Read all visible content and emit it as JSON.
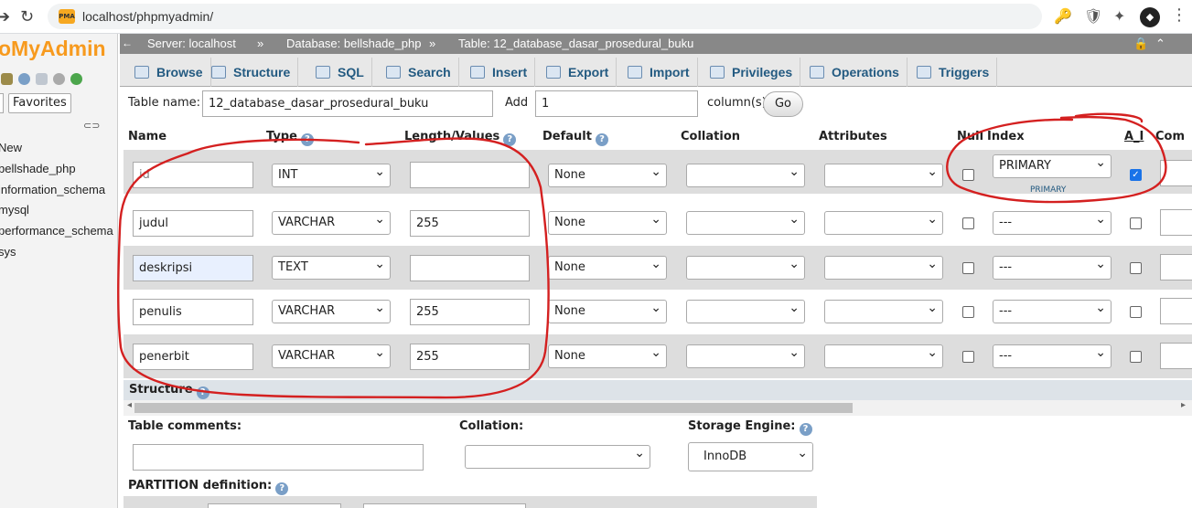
{
  "browser": {
    "url": "localhost/phpmyadmin/",
    "favicon_text": "PMA"
  },
  "sidebar": {
    "logo": "oMyAdmin",
    "favorites_label": "Favorites",
    "databases": [
      "New",
      "bellshade_php",
      "information_schema",
      "mysql",
      "performance_schema",
      "sys"
    ]
  },
  "breadcrumb": {
    "server": "Server: localhost",
    "database": "Database: bellshade_php",
    "table": "Table: 12_database_dasar_prosedural_buku",
    "sep": "»"
  },
  "tabs": [
    "Browse",
    "Structure",
    "SQL",
    "Search",
    "Insert",
    "Export",
    "Import",
    "Privileges",
    "Operations",
    "Triggers"
  ],
  "form": {
    "table_name_label": "Table name:",
    "table_name_value": "12_database_dasar_prosedural_buku",
    "add_label": "Add",
    "add_value": "1",
    "columns_label": "column(s)",
    "go_label": "Go"
  },
  "columns_header": {
    "name": "Name",
    "type": "Type",
    "length": "Length/Values",
    "default": "Default",
    "collation": "Collation",
    "attributes": "Attributes",
    "null": "Null",
    "index": "Index",
    "ai": "A_I",
    "comments": "Com"
  },
  "rows": [
    {
      "name": "id",
      "type": "INT",
      "length": "",
      "default": "None",
      "index": "PRIMARY",
      "index_note": "PRIMARY",
      "ai": true,
      "null": false
    },
    {
      "name": "judul",
      "type": "VARCHAR",
      "length": "255",
      "default": "None",
      "index": "---",
      "ai": false,
      "null": false
    },
    {
      "name": "deskripsi",
      "type": "TEXT",
      "length": "",
      "default": "None",
      "index": "---",
      "ai": false,
      "null": false
    },
    {
      "name": "penulis",
      "type": "VARCHAR",
      "length": "255",
      "default": "None",
      "index": "---",
      "ai": false,
      "null": false
    },
    {
      "name": "penerbit",
      "type": "VARCHAR",
      "length": "255",
      "default": "None",
      "index": "---",
      "ai": false,
      "null": false
    }
  ],
  "structure_label": "Structure",
  "options": {
    "table_comments_label": "Table comments:",
    "collation_label": "Collation:",
    "storage_engine_label": "Storage Engine:",
    "storage_engine_value": "InnoDB",
    "partition_label": "PARTITION definition:"
  },
  "colors": {
    "accent": "#235a81",
    "annotation": "#d42020",
    "logo": "#f79a1e"
  }
}
